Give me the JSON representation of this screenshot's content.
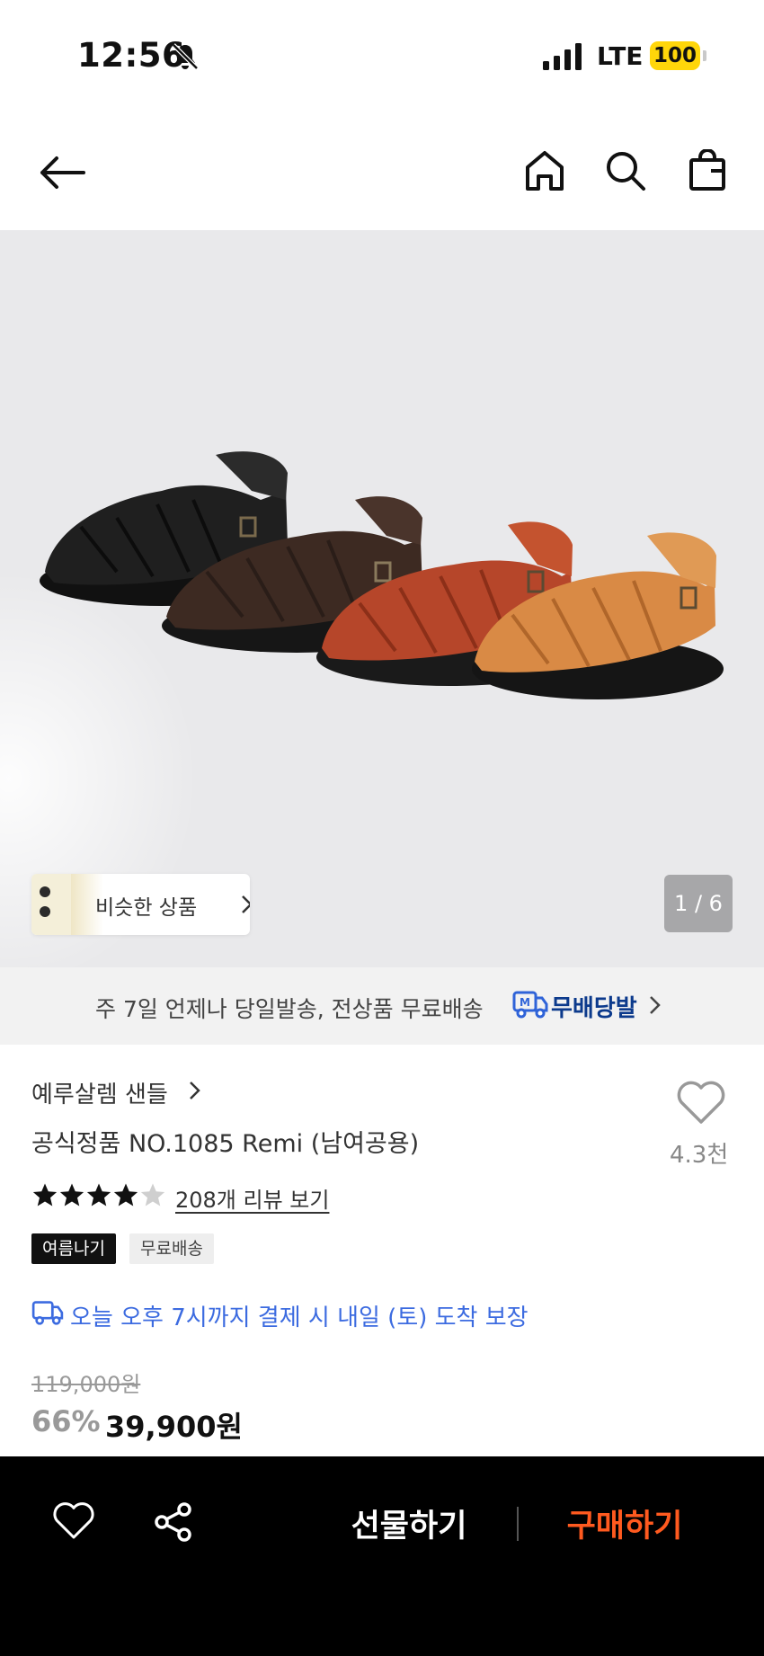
{
  "status_bar": {
    "time": "12:56",
    "network": "LTE",
    "battery": "100"
  },
  "header": {
    "icons": [
      "back-arrow-icon",
      "home-icon",
      "search-icon",
      "shopping-bag-icon"
    ]
  },
  "gallery": {
    "similar_label": "비슷한 상품",
    "page_indicator": "1 / 6",
    "sandal_colors": [
      "#1f1f1f",
      "#3d2a22",
      "#b6462a",
      "#d98a45"
    ]
  },
  "shipping_banner": {
    "text": "주 7일 언제나 당일발송, 전상품 무료배송",
    "badge_letter": "M",
    "badge_label": "무배당발"
  },
  "product": {
    "brand": "예루살렘 샌들",
    "name": "공식정품 NO.1085 Remi (남여공용)",
    "wish_count": "4.3천",
    "rating": 4,
    "rating_max": 5,
    "review_link": "208개 리뷰 보기",
    "tags": [
      "여름나기",
      "무료배송"
    ],
    "delivery_notice": "오늘 오후 7시까지 결제 시 내일 (토) 도착 보장",
    "original_price": "119,000원",
    "discount": "66%",
    "sale_price": "39,900원"
  },
  "bottom_bar": {
    "gift_label": "선물하기",
    "buy_label": "구매하기",
    "buy_color": "#ff5a1f"
  }
}
